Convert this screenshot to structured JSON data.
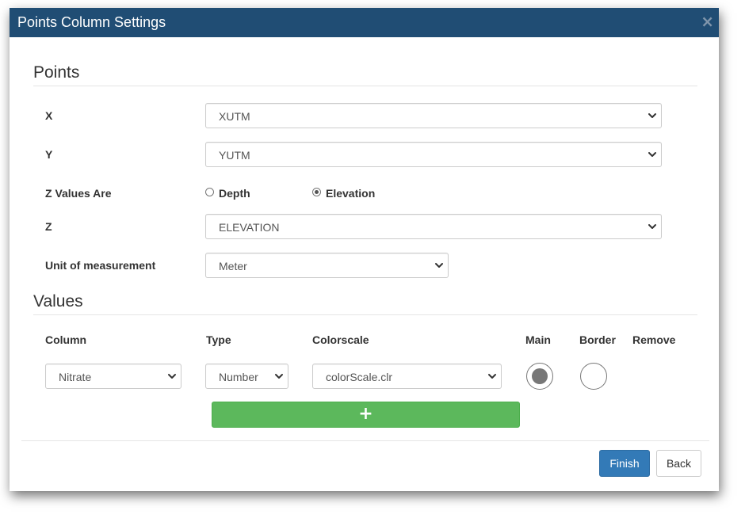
{
  "dialog": {
    "title": "Points Column Settings",
    "close_symbol": "×"
  },
  "points": {
    "section_title": "Points",
    "x": {
      "label": "X",
      "value": "XUTM"
    },
    "y": {
      "label": "Y",
      "value": "YUTM"
    },
    "z_values_are": {
      "label": "Z Values Are",
      "options": [
        {
          "label": "Depth",
          "checked": false
        },
        {
          "label": "Elevation",
          "checked": true
        }
      ]
    },
    "z": {
      "label": "Z",
      "value": "ELEVATION"
    },
    "unit": {
      "label": "Unit of measurement",
      "value": "Meter"
    }
  },
  "values": {
    "section_title": "Values",
    "columns": {
      "column": "Column",
      "type": "Type",
      "colorscale": "Colorscale",
      "main": "Main",
      "border": "Border",
      "remove": "Remove"
    },
    "rows": [
      {
        "column": "Nitrate",
        "type": "Number",
        "colorscale": "colorScale.clr",
        "main_selected": true,
        "border_selected": false
      }
    ],
    "add_symbol": "+"
  },
  "footer": {
    "finish_label": "Finish",
    "back_label": "Back"
  },
  "colors": {
    "titlebar": "#204d74",
    "primary": "#337ab7",
    "success": "#5cb85c"
  },
  "icons": {
    "select_arrow": "chevron-down-icon",
    "close": "close-icon",
    "add": "plus-icon"
  }
}
